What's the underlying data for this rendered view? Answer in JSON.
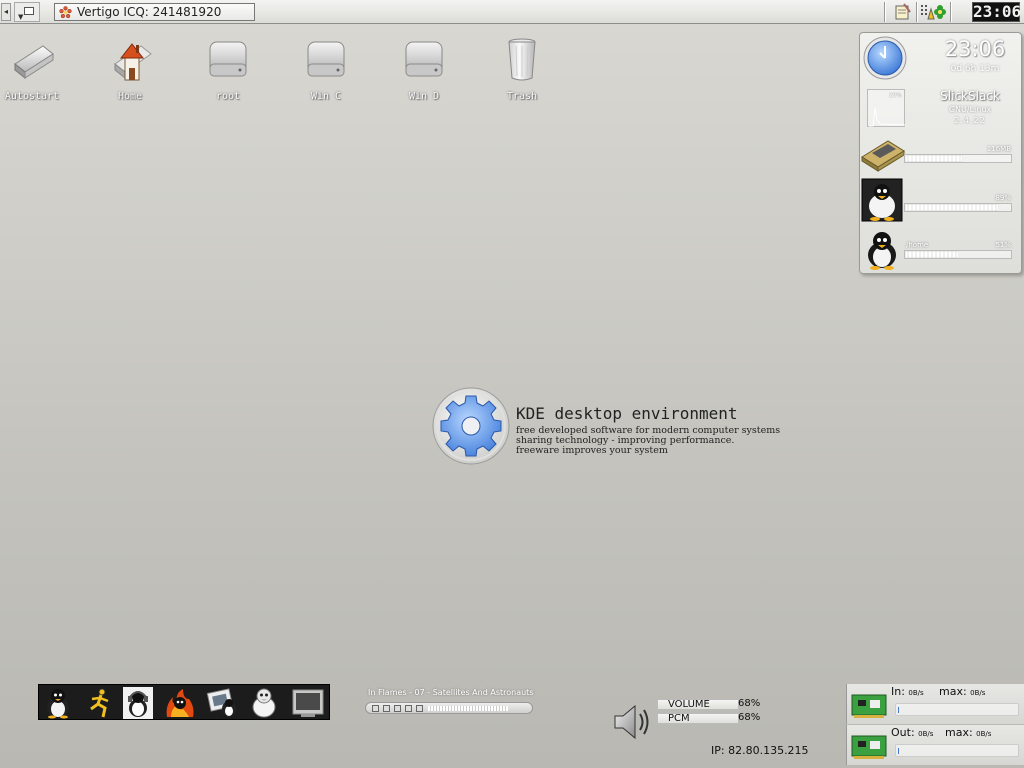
{
  "top_panel": {
    "left_arrow": "◂",
    "task_title": "Vertigo ICQ: 241481920",
    "clock": "23:06"
  },
  "desktop_icons": [
    {
      "label": "Autostart",
      "icon": "drive-icon"
    },
    {
      "label": "Home",
      "icon": "home-icon"
    },
    {
      "label": "root",
      "icon": "hard-disk-icon"
    },
    {
      "label": "Win C",
      "icon": "hard-disk-icon"
    },
    {
      "label": "Win D",
      "icon": "hard-disk-icon"
    },
    {
      "label": "Trash",
      "icon": "trash-icon"
    }
  ],
  "system_monitor": {
    "time": "23:06",
    "uptime": "0d 6h 13m",
    "cpu_percent_label": "29%",
    "hostname": "SlickSlack",
    "os": "GNU/Linux",
    "kernel": "2.4.22",
    "memory_label": "116MB",
    "memory_fraction": 0.55,
    "root_percent_label": "89%",
    "root_fraction": 0.89,
    "home_path": "/home",
    "home_percent_label": "51%",
    "home_fraction": 0.51
  },
  "kde_logo": {
    "title": "KDE desktop environment",
    "line1": "free developed software for modern computer systems",
    "line2": "sharing technology - improving performance.",
    "line3": "freeware improves your system"
  },
  "launcher": {
    "items": [
      "tux-icon",
      "runner-icon",
      "headphones-tux-icon",
      "fire-tux-icon",
      "photo-tux-icon",
      "tux-icon",
      "screen-icon"
    ]
  },
  "player": {
    "track": "In Flames - 07 - Satellites And Astronauts",
    "controls": [
      "prev-icon",
      "play-icon",
      "pause-icon",
      "stop-icon",
      "next-icon"
    ],
    "progress_fraction": 0.1
  },
  "volume": {
    "volume_label": "VOLUME",
    "volume_percent": "68%",
    "pcm_label": "PCM",
    "pcm_percent": "68%",
    "ip_text": "IP: 82.80.135.215"
  },
  "network": {
    "in_label": "In:",
    "in_value": "0B/s",
    "in_max_label": "max:",
    "in_max_value": "0B/s",
    "out_label": "Out:",
    "out_value": "0B/s",
    "out_max_label": "max:",
    "out_max_value": "0B/s"
  }
}
